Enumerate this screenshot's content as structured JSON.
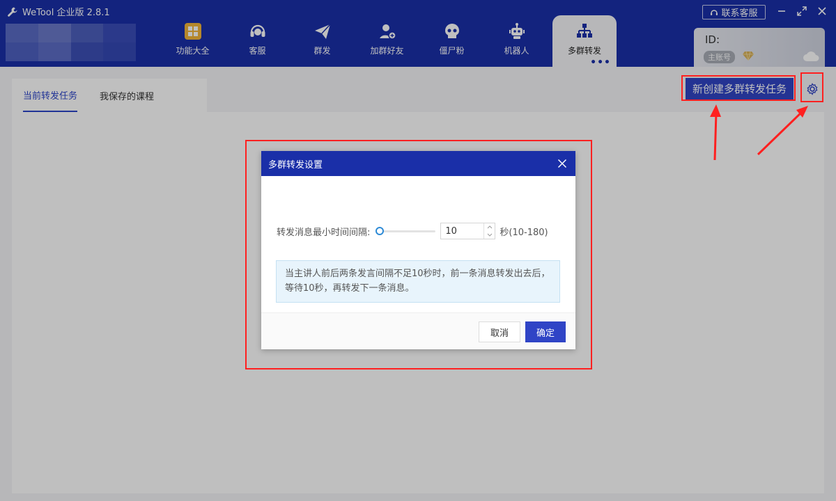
{
  "app": {
    "title": "WeTool 企业版 2.8.1",
    "logo_icon": "wrench-icon"
  },
  "nav": {
    "items": [
      {
        "label": "功能大全",
        "icon": "grid-icon"
      },
      {
        "label": "客服",
        "icon": "headset-icon"
      },
      {
        "label": "群发",
        "icon": "paper-plane-icon"
      },
      {
        "label": "加群好友",
        "icon": "add-user-icon"
      },
      {
        "label": "僵尸粉",
        "icon": "skull-icon"
      },
      {
        "label": "机器人",
        "icon": "robot-icon"
      },
      {
        "label": "多群转发",
        "icon": "org-chart-icon",
        "active": true,
        "more": "•••"
      }
    ]
  },
  "header": {
    "contact_label": "联系客服"
  },
  "account": {
    "id_label": "ID:",
    "badge": "主账号"
  },
  "tabs": [
    {
      "label": "当前转发任务",
      "active": true
    },
    {
      "label": "我保存的课程",
      "active": false
    }
  ],
  "toolbar": {
    "new_task_label": "新创建多群转发任务"
  },
  "dialog": {
    "title": "多群转发设置",
    "setting_label": "转发消息最小时间间隔:",
    "interval_value": "10",
    "interval_min": 10,
    "interval_max": 180,
    "unit_label": "秒(10-180)",
    "tip": "当主讲人前后两条发言间隔不足10秒时，前一条消息转发出去后，等待10秒，再转发下一条消息。",
    "cancel_label": "取消",
    "ok_label": "确定"
  },
  "colors": {
    "header_bg": "#1a2fa8",
    "primary": "#3045c4",
    "annotation": "#ff2020"
  }
}
